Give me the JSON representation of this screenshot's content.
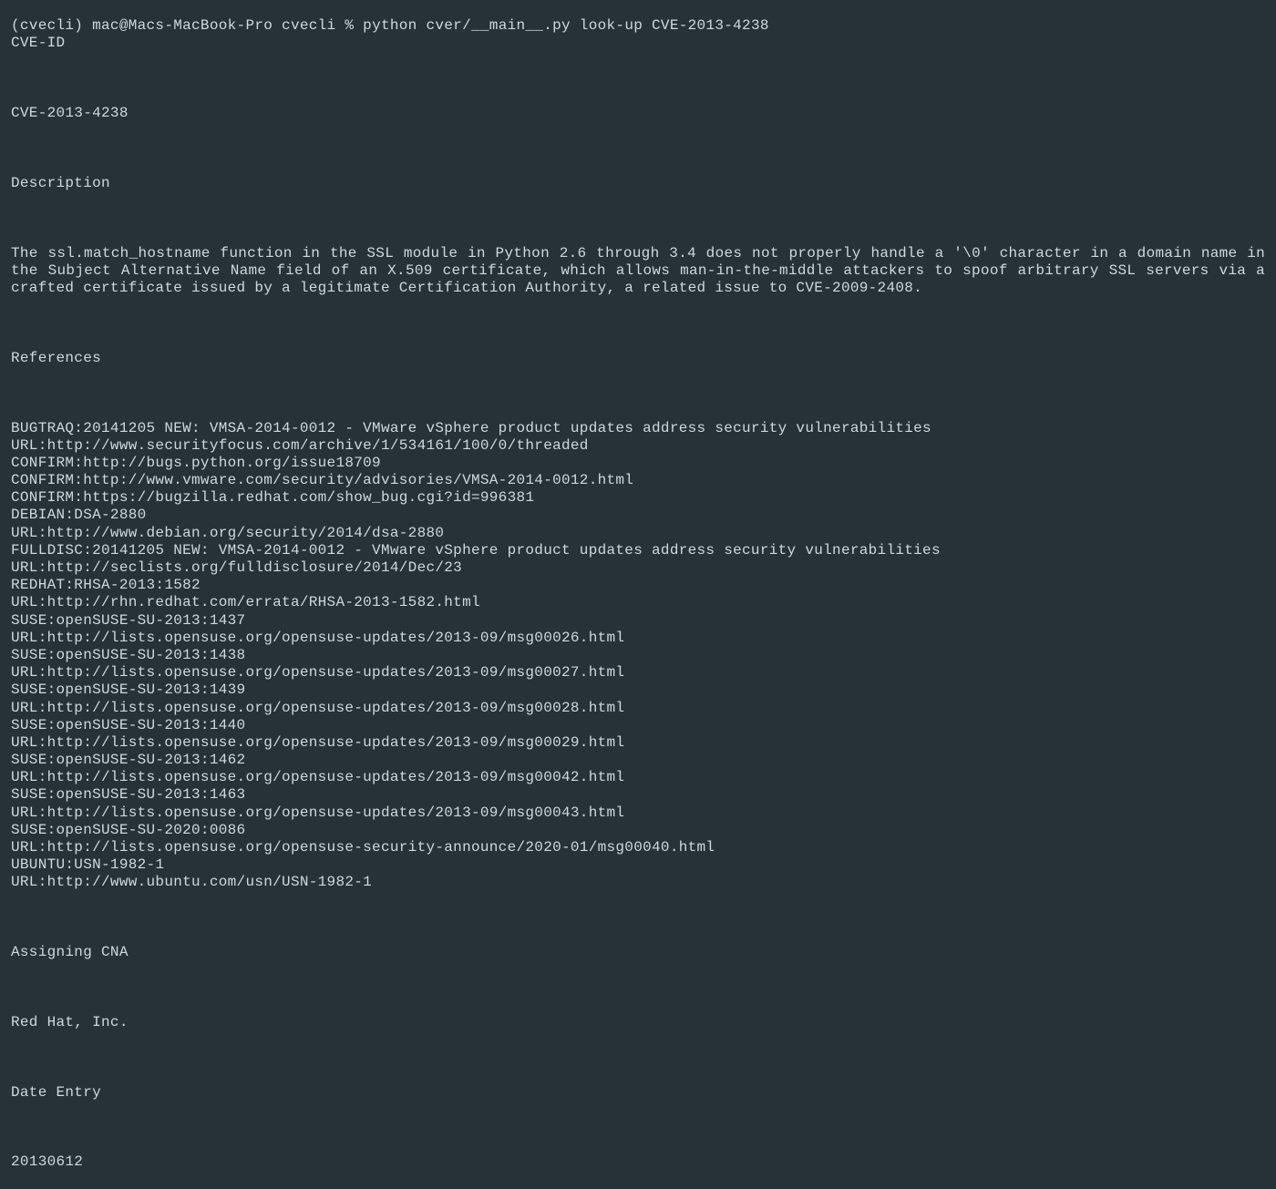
{
  "prompt": {
    "prefix": "(cvecli) mac@Macs-MacBook-Pro cvecli % ",
    "command": "python cver/__main__.py look-up CVE-2013-4238"
  },
  "sections": {
    "cve_id_label": "CVE-ID",
    "cve_id_value": "CVE-2013-4238",
    "description_label": "Description",
    "description_text": "The ssl.match_hostname function in the SSL module in Python 2.6 through 3.4 does not properly handle a '\\0' character in a domain name in the Subject Alternative Name field of an X.509 certificate, which allows man-in-the-middle attackers to spoof arbitrary SSL servers via a crafted certificate issued by a legitimate Certification Authority, a related issue to CVE-2009-2408.",
    "references_label": "References",
    "references": [
      "BUGTRAQ:20141205 NEW: VMSA-2014-0012 - VMware vSphere product updates address security vulnerabilities",
      "URL:http://www.securityfocus.com/archive/1/534161/100/0/threaded",
      "CONFIRM:http://bugs.python.org/issue18709",
      "CONFIRM:http://www.vmware.com/security/advisories/VMSA-2014-0012.html",
      "CONFIRM:https://bugzilla.redhat.com/show_bug.cgi?id=996381",
      "DEBIAN:DSA-2880",
      "URL:http://www.debian.org/security/2014/dsa-2880",
      "FULLDISC:20141205 NEW: VMSA-2014-0012 - VMware vSphere product updates address security vulnerabilities",
      "URL:http://seclists.org/fulldisclosure/2014/Dec/23",
      "REDHAT:RHSA-2013:1582",
      "URL:http://rhn.redhat.com/errata/RHSA-2013-1582.html",
      "SUSE:openSUSE-SU-2013:1437",
      "URL:http://lists.opensuse.org/opensuse-updates/2013-09/msg00026.html",
      "SUSE:openSUSE-SU-2013:1438",
      "URL:http://lists.opensuse.org/opensuse-updates/2013-09/msg00027.html",
      "SUSE:openSUSE-SU-2013:1439",
      "URL:http://lists.opensuse.org/opensuse-updates/2013-09/msg00028.html",
      "SUSE:openSUSE-SU-2013:1440",
      "URL:http://lists.opensuse.org/opensuse-updates/2013-09/msg00029.html",
      "SUSE:openSUSE-SU-2013:1462",
      "URL:http://lists.opensuse.org/opensuse-updates/2013-09/msg00042.html",
      "SUSE:openSUSE-SU-2013:1463",
      "URL:http://lists.opensuse.org/opensuse-updates/2013-09/msg00043.html",
      "SUSE:openSUSE-SU-2020:0086",
      "URL:http://lists.opensuse.org/opensuse-security-announce/2020-01/msg00040.html",
      "UBUNTU:USN-1982-1",
      "URL:http://www.ubuntu.com/usn/USN-1982-1"
    ],
    "assigning_cna_label": "Assigning CNA",
    "assigning_cna_value": "Red Hat, Inc.",
    "date_entry_label": "Date Entry",
    "date_entry_value": "20130612"
  }
}
